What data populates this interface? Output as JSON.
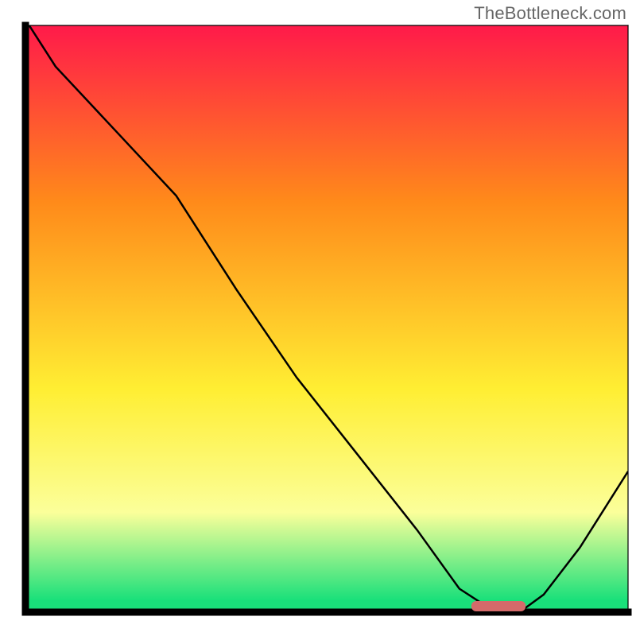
{
  "attribution": "TheBottleneck.com",
  "colors": {
    "red": "#ff1a4a",
    "orange": "#ff8a1a",
    "yellow": "#ffee33",
    "light_yellow": "#fbff9a",
    "green": "#19e07a",
    "axis": "#000000",
    "trough_marker": "#d46a6a",
    "curve": "#000000"
  },
  "chart_data": {
    "type": "line",
    "title": "",
    "xlabel": "",
    "ylabel": "",
    "xlim": [
      0,
      100
    ],
    "ylim": [
      0,
      100
    ],
    "x": [
      0,
      5,
      15,
      25,
      35,
      45,
      55,
      65,
      72,
      78,
      82,
      86,
      92,
      100
    ],
    "values": [
      101,
      93,
      82,
      71,
      55,
      40,
      27,
      14,
      4,
      0,
      0,
      3,
      11,
      24
    ],
    "trough_range_x": [
      74,
      83
    ],
    "gradient_stops_screen_pct": [
      {
        "offset": 0,
        "key": "red"
      },
      {
        "offset": 30,
        "key": "orange"
      },
      {
        "offset": 62,
        "key": "yellow"
      },
      {
        "offset": 83,
        "key": "light_yellow"
      },
      {
        "offset": 98,
        "key": "green"
      }
    ]
  }
}
